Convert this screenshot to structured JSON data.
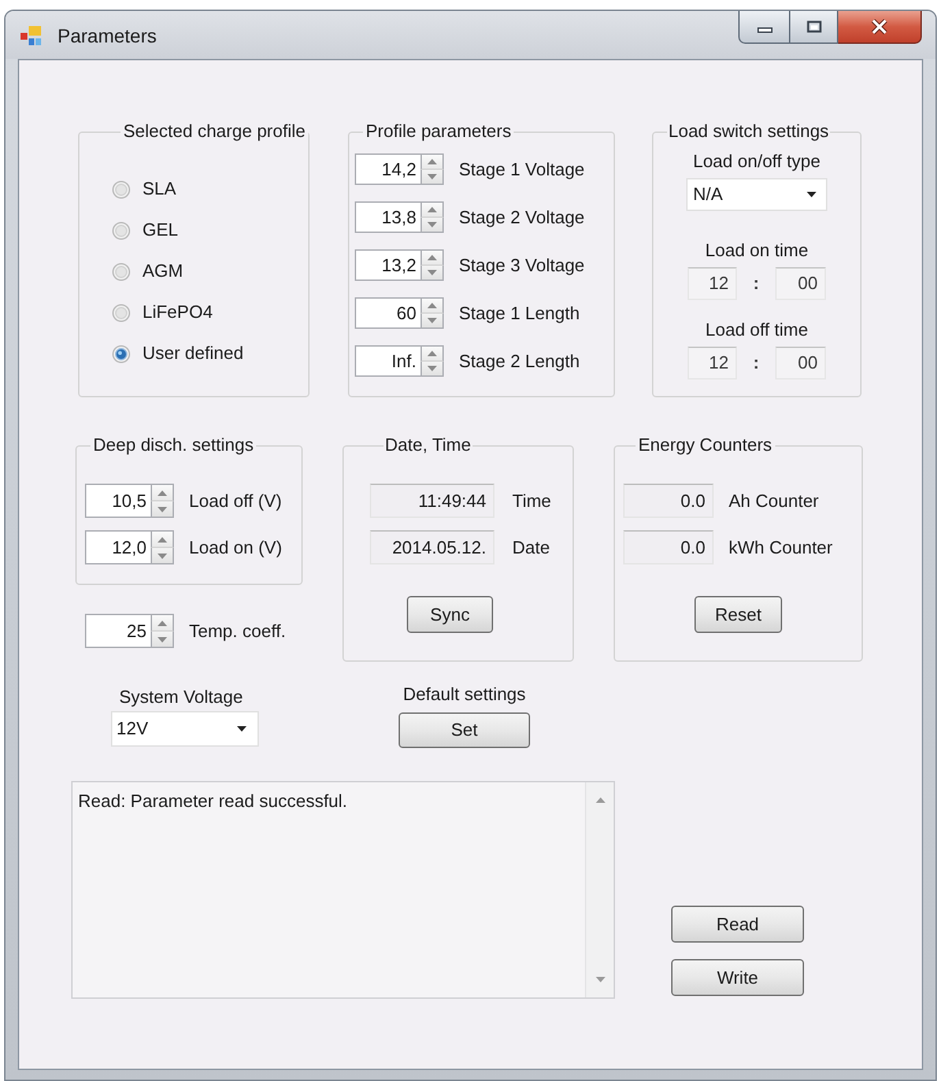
{
  "window": {
    "title": "Parameters"
  },
  "charge_profile": {
    "title": "Selected charge profile",
    "options": [
      {
        "label": "SLA",
        "selected": false
      },
      {
        "label": "GEL",
        "selected": false
      },
      {
        "label": "AGM",
        "selected": false
      },
      {
        "label": "LiFePO4",
        "selected": false
      },
      {
        "label": "User defined",
        "selected": true
      }
    ]
  },
  "profile_parameters": {
    "title": "Profile parameters",
    "rows": [
      {
        "value": "14,2",
        "label": "Stage 1 Voltage"
      },
      {
        "value": "13,8",
        "label": "Stage 2 Voltage"
      },
      {
        "value": "13,2",
        "label": "Stage 3 Voltage"
      },
      {
        "value": "60",
        "label": "Stage 1 Length"
      },
      {
        "value": "Inf.",
        "label": "Stage 2 Length"
      }
    ]
  },
  "load_switch": {
    "title": "Load switch settings",
    "type_label": "Load on/off type",
    "type_value": "N/A",
    "times": [
      {
        "label": "Load on time",
        "hour": "12",
        "separator": ":",
        "minute": "00"
      },
      {
        "label": "Load off time",
        "hour": "12",
        "separator": ":",
        "minute": "00"
      }
    ]
  },
  "deep_discharge": {
    "title": "Deep disch. settings",
    "rows": [
      {
        "value": "10,5",
        "label": "Load off (V)"
      },
      {
        "value": "12,0",
        "label": "Load on (V)"
      }
    ]
  },
  "date_time": {
    "title": "Date, Time",
    "rows": [
      {
        "value": "11:49:44",
        "label": "Time"
      },
      {
        "value": "2014.05.12.",
        "label": "Date"
      }
    ],
    "button": "Sync"
  },
  "energy_counters": {
    "title": "Energy Counters",
    "rows": [
      {
        "value": "0.0",
        "label": "Ah Counter"
      },
      {
        "value": "0.0",
        "label": "kWh Counter"
      }
    ],
    "button": "Reset"
  },
  "temp_coeff": {
    "value": "25",
    "label": "Temp. coeff."
  },
  "system_voltage": {
    "label": "System Voltage",
    "value": "12V"
  },
  "default_settings": {
    "label": "Default settings",
    "button": "Set"
  },
  "log": {
    "value": "Read: Parameter read successful."
  },
  "buttons": [
    "Read",
    "Write"
  ]
}
